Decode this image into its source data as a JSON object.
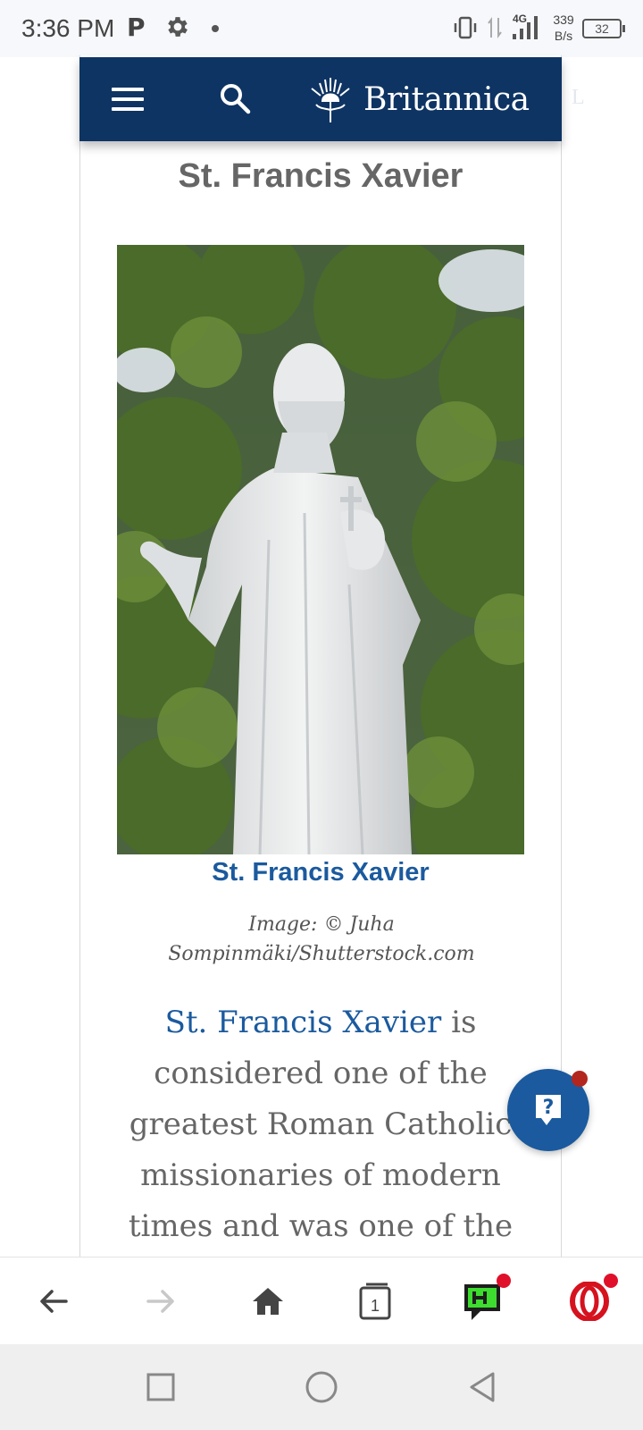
{
  "status_bar": {
    "time": "3:36 PM",
    "p_label": "P",
    "network_type": "4G",
    "speed_value": "339",
    "speed_unit": "B/s",
    "battery": "32"
  },
  "header": {
    "brand": "Britannica",
    "overflow_letter": "L"
  },
  "article": {
    "title": "St. Francis Xavier",
    "image_caption": "St. Francis Xavier",
    "image_credit": "Image: © Juha Sompinmäki/Shutterstock.com",
    "body_link": "St. Francis Xavier",
    "body_text": " is considered one of the greatest Roman Catholic missionaries of modern times and was one of the"
  },
  "help_button": {
    "icon": "question-mark-icon"
  },
  "toolbar": {
    "tab_count": "1",
    "icons": [
      "back-arrow-icon",
      "forward-arrow-icon",
      "home-icon",
      "tabs-icon",
      "game-icon",
      "opera-icon"
    ]
  },
  "navbar": {
    "icons": [
      "recents-square-icon",
      "home-circle-icon",
      "back-triangle-icon"
    ]
  },
  "colors": {
    "header_bg": "#0e3463",
    "link_blue": "#1b5a9e",
    "badge_red": "#e0102a"
  }
}
